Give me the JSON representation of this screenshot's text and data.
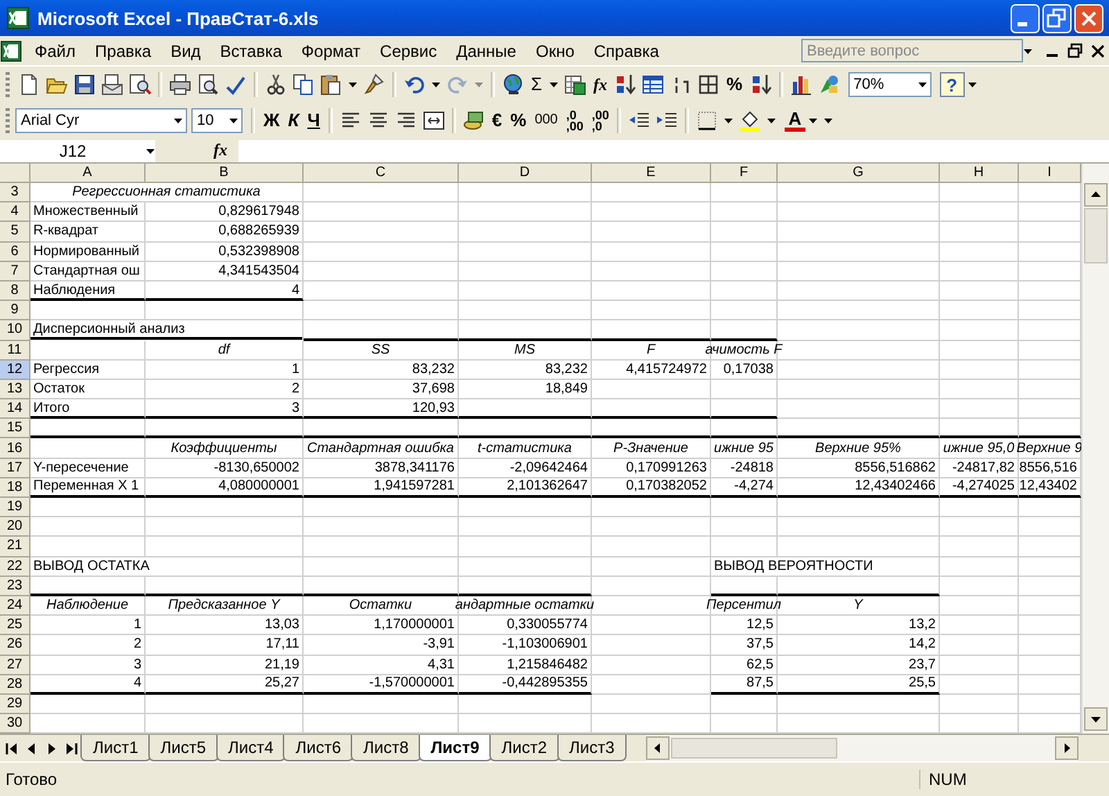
{
  "window": {
    "title": "Microsoft Excel - ПравСтат-6.xls"
  },
  "menu": [
    {
      "label": "Файл"
    },
    {
      "label": "Правка"
    },
    {
      "label": "Вид"
    },
    {
      "label": "Вставка"
    },
    {
      "label": "Формат"
    },
    {
      "label": "Сервис"
    },
    {
      "label": "Данные"
    },
    {
      "label": "Окно"
    },
    {
      "label": "Справка"
    }
  ],
  "help_box": {
    "placeholder": "Введите вопрос"
  },
  "standard_toolbar": {
    "autosum": "Σ",
    "function": "fx",
    "percent": "%",
    "zoom": "70%",
    "help": "?",
    "redo": {
      "disabled": true
    }
  },
  "formatting_toolbar": {
    "font": "Arial Cyr",
    "size": "10",
    "bold": "Ж",
    "italic": "К",
    "underline": "Ч",
    "euro": "€",
    "percent": "%",
    "thousands": "000",
    "increase_decimal": {
      "top": ",0",
      "bottom": ",00"
    },
    "decrease_decimal": {
      "top": ",00",
      "bottom": ",0"
    },
    "font_color": "A"
  },
  "formula_bar": {
    "name_box": "J12",
    "fx": "fx"
  },
  "sheet": {
    "columns": [
      "A",
      "B",
      "C",
      "D",
      "E",
      "F",
      "G",
      "H",
      "I"
    ],
    "rows": [
      {
        "number": "3",
        "selected": false,
        "cells": [
          {
            "text": "Регрессионная статистика",
            "kind": "title"
          }
        ]
      },
      {
        "number": "4",
        "selected": false,
        "cells": [
          {
            "text": "Множественный",
            "kind": "text"
          },
          {
            "text": "0,829617948",
            "kind": "number"
          }
        ]
      },
      {
        "number": "5",
        "selected": false,
        "cells": [
          {
            "text": "R-квадрат",
            "kind": "text"
          },
          {
            "text": "0,688265939",
            "kind": "number"
          }
        ]
      },
      {
        "number": "6",
        "selected": false,
        "cells": [
          {
            "text": "Нормированный",
            "kind": "text"
          },
          {
            "text": "0,532398908",
            "kind": "number"
          }
        ]
      },
      {
        "number": "7",
        "selected": false,
        "cells": [
          {
            "text": "Стандартная ош",
            "kind": "text"
          },
          {
            "text": "4,341543504",
            "kind": "number"
          }
        ]
      },
      {
        "number": "8",
        "selected": false,
        "cells": [
          {
            "text": "Наблюдения",
            "kind": "text",
            "ruled": true
          },
          {
            "text": "4",
            "kind": "number",
            "ruled": true
          }
        ]
      },
      {
        "number": "9",
        "selected": false,
        "cells": []
      },
      {
        "number": "10",
        "selected": false,
        "cells": [
          {
            "text": "Дисперсионный анализ",
            "kind": "text",
            "ruled": true
          },
          {
            "ruled": true
          },
          {
            "ruled": true
          },
          {
            "ruled": true
          },
          {
            "ruled": true
          },
          {
            "ruled": true
          }
        ]
      },
      {
        "number": "11",
        "selected": false,
        "cells": [
          "",
          {
            "text": "df",
            "kind": "heading"
          },
          {
            "text": "SS",
            "kind": "heading"
          },
          {
            "text": "MS",
            "kind": "heading"
          },
          {
            "text": "F",
            "kind": "heading"
          },
          {
            "text": "ачимость F",
            "kind": "heading"
          }
        ]
      },
      {
        "number": "12",
        "selected": true,
        "cells": [
          {
            "text": "Регрессия",
            "kind": "text"
          },
          {
            "text": "1",
            "kind": "number"
          },
          {
            "text": "83,232",
            "kind": "number"
          },
          {
            "text": "83,232",
            "kind": "number"
          },
          {
            "text": "4,415724972",
            "kind": "number"
          },
          {
            "text": "0,17038",
            "kind": "number"
          }
        ]
      },
      {
        "number": "13",
        "selected": false,
        "cells": [
          {
            "text": "Остаток",
            "kind": "text"
          },
          {
            "text": "2",
            "kind": "number"
          },
          {
            "text": "37,698",
            "kind": "number"
          },
          {
            "text": "18,849",
            "kind": "number"
          }
        ]
      },
      {
        "number": "14",
        "selected": false,
        "cells": [
          {
            "text": "Итого",
            "kind": "text",
            "ruled": true
          },
          {
            "text": "3",
            "kind": "number",
            "ruled": true
          },
          {
            "text": "120,93",
            "kind": "number",
            "ruled": true
          },
          {
            "ruled": true
          },
          {
            "ruled": true
          },
          {
            "ruled": true
          }
        ]
      },
      {
        "number": "15",
        "selected": false,
        "cells": [
          {
            "ruled": true
          },
          {
            "ruled": true
          },
          {
            "ruled": true
          },
          {
            "ruled": true
          },
          {
            "ruled": true
          },
          {
            "ruled": true
          },
          {
            "ruled": true
          },
          {
            "ruled": true
          },
          {
            "ruled": true
          }
        ]
      },
      {
        "number": "16",
        "selected": false,
        "cells": [
          "",
          {
            "text": "Коэффициенты",
            "kind": "heading"
          },
          {
            "text": "Стандартная ошибка",
            "kind": "heading"
          },
          {
            "text": "t-статистика",
            "kind": "heading"
          },
          {
            "text": "P-Значение",
            "kind": "heading"
          },
          {
            "text": "ижние 95",
            "kind": "heading"
          },
          {
            "text": "Верхние 95%",
            "kind": "heading"
          },
          {
            "text": "ижние 95,0",
            "kind": "heading"
          },
          {
            "text": "Верхние 9",
            "kind": "heading"
          }
        ]
      },
      {
        "number": "17",
        "selected": false,
        "cells": [
          {
            "text": "Y-пересечение",
            "kind": "text"
          },
          {
            "text": "-8130,650002",
            "kind": "number"
          },
          {
            "text": "3878,341176",
            "kind": "number"
          },
          {
            "text": "-2,09642464",
            "kind": "number"
          },
          {
            "text": "0,170991263",
            "kind": "number"
          },
          {
            "text": "-24818",
            "kind": "number"
          },
          {
            "text": "8556,516862",
            "kind": "number"
          },
          {
            "text": "-24817,82",
            "kind": "number"
          },
          {
            "text": "8556,516",
            "kind": "number"
          }
        ]
      },
      {
        "number": "18",
        "selected": false,
        "cells": [
          {
            "text": "Переменная X 1",
            "kind": "text",
            "ruled": true
          },
          {
            "text": "4,080000001",
            "kind": "number",
            "ruled": true
          },
          {
            "text": "1,941597281",
            "kind": "number",
            "ruled": true
          },
          {
            "text": "2,101362647",
            "kind": "number",
            "ruled": true
          },
          {
            "text": "0,170382052",
            "kind": "number",
            "ruled": true
          },
          {
            "text": "-4,274",
            "kind": "number",
            "ruled": true
          },
          {
            "text": "12,43402466",
            "kind": "number",
            "ruled": true
          },
          {
            "text": "-4,274025",
            "kind": "number",
            "ruled": true
          },
          {
            "text": "12,43402",
            "kind": "number",
            "ruled": true
          }
        ]
      },
      {
        "number": "19",
        "selected": false,
        "cells": []
      },
      {
        "number": "20",
        "selected": false,
        "cells": []
      },
      {
        "number": "21",
        "selected": false,
        "cells": []
      },
      {
        "number": "22",
        "selected": false,
        "cells": [
          {
            "text": "ВЫВОД ОСТАТКА",
            "kind": "text"
          },
          "",
          "",
          "",
          "",
          {
            "text": "ВЫВОД ВЕРОЯТНОСТИ",
            "kind": "text"
          }
        ]
      },
      {
        "number": "23",
        "selected": false,
        "cells": [
          {
            "ruled": true
          },
          {
            "ruled": true
          },
          {
            "ruled": true
          },
          {
            "ruled": true
          },
          "",
          {
            "ruled": true
          },
          {
            "ruled": true
          }
        ]
      },
      {
        "number": "24",
        "selected": false,
        "cells": [
          {
            "text": "Наблюдение",
            "kind": "heading"
          },
          {
            "text": "Предсказанное Y",
            "kind": "heading"
          },
          {
            "text": "Остатки",
            "kind": "heading"
          },
          {
            "text": "андартные остатки",
            "kind": "heading"
          },
          "",
          {
            "text": "Персентил",
            "kind": "heading"
          },
          {
            "text": "Y",
            "kind": "heading"
          }
        ]
      },
      {
        "number": "25",
        "selected": false,
        "cells": [
          {
            "text": "1",
            "kind": "number"
          },
          {
            "text": "13,03",
            "kind": "number"
          },
          {
            "text": "1,170000001",
            "kind": "number"
          },
          {
            "text": "0,330055774",
            "kind": "number"
          },
          "",
          {
            "text": "12,5",
            "kind": "number"
          },
          {
            "text": "13,2",
            "kind": "number"
          }
        ]
      },
      {
        "number": "26",
        "selected": false,
        "cells": [
          {
            "text": "2",
            "kind": "number"
          },
          {
            "text": "17,11",
            "kind": "number"
          },
          {
            "text": "-3,91",
            "kind": "number"
          },
          {
            "text": "-1,103006901",
            "kind": "number"
          },
          "",
          {
            "text": "37,5",
            "kind": "number"
          },
          {
            "text": "14,2",
            "kind": "number"
          }
        ]
      },
      {
        "number": "27",
        "selected": false,
        "cells": [
          {
            "text": "3",
            "kind": "number"
          },
          {
            "text": "21,19",
            "kind": "number"
          },
          {
            "text": "4,31",
            "kind": "number"
          },
          {
            "text": "1,215846482",
            "kind": "number"
          },
          "",
          {
            "text": "62,5",
            "kind": "number"
          },
          {
            "text": "23,7",
            "kind": "number"
          }
        ]
      },
      {
        "number": "28",
        "selected": false,
        "cells": [
          {
            "text": "4",
            "kind": "number",
            "ruled": true
          },
          {
            "text": "25,27",
            "kind": "number",
            "ruled": true
          },
          {
            "text": "-1,570000001",
            "kind": "number",
            "ruled": true
          },
          {
            "text": "-0,442895355",
            "kind": "number",
            "ruled": true
          },
          "",
          {
            "text": "87,5",
            "kind": "number",
            "ruled": true
          },
          {
            "text": "25,5",
            "kind": "number",
            "ruled": true
          }
        ]
      },
      {
        "number": "29",
        "selected": false,
        "cells": []
      },
      {
        "number": "30",
        "selected": false,
        "cells": []
      }
    ]
  },
  "sheet_tabs": [
    {
      "label": "Лист1",
      "selected": false
    },
    {
      "label": "Лист5",
      "selected": false
    },
    {
      "label": "Лист4",
      "selected": false
    },
    {
      "label": "Лист6",
      "selected": false
    },
    {
      "label": "Лист8",
      "selected": false
    },
    {
      "label": "Лист9",
      "selected": true
    },
    {
      "label": "Лист2",
      "selected": false
    },
    {
      "label": "Лист3",
      "selected": false
    }
  ],
  "status_bar": {
    "message": "Готово",
    "num_lock": "NUM"
  }
}
